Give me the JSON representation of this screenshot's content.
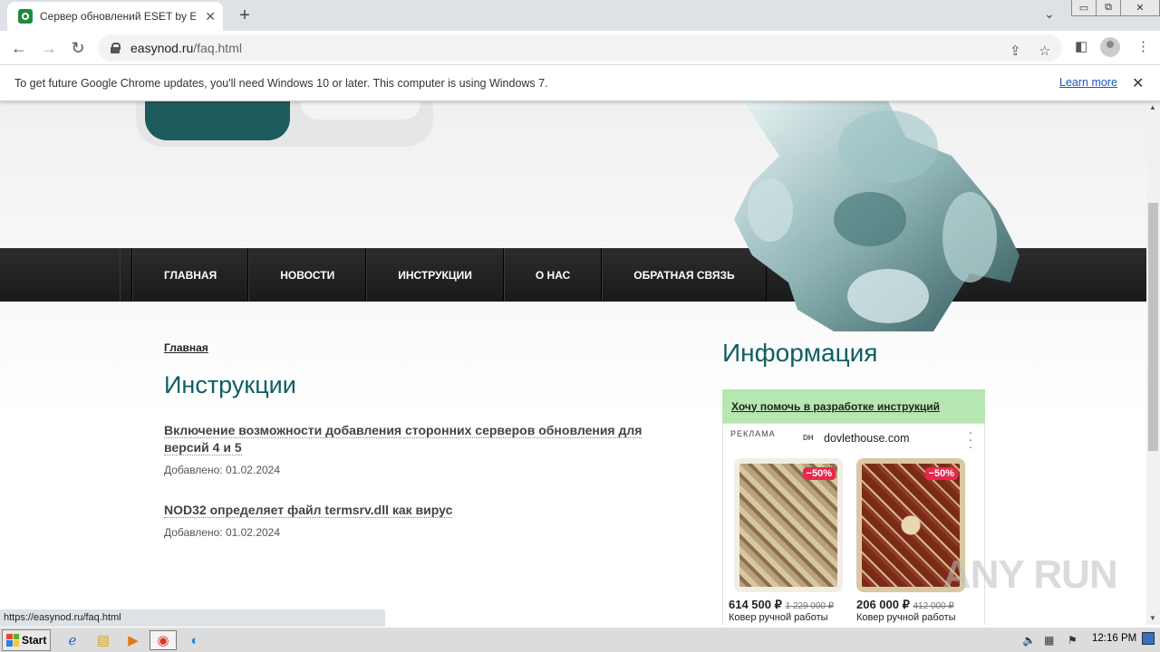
{
  "browser": {
    "tab_title": "Сервер обновлений ESET by EasyNod",
    "url_domain": "easynod.ru",
    "url_path": "/faq.html",
    "new_tab_icon": "plus-icon"
  },
  "infobar": {
    "message": "To get future Google Chrome updates, you'll need Windows 10 or later. This computer is using Windows 7.",
    "learn_more": "Learn more"
  },
  "site": {
    "nav": [
      "ГЛАВНАЯ",
      "НОВОСТИ",
      "ИНСТРУКЦИИ",
      "О НАС",
      "ОБРАТНАЯ СВЯЗЬ"
    ],
    "breadcrumb": "Главная",
    "page_title": "Инструкции",
    "articles": [
      {
        "title": "Включение возможности добавления сторонних серверов обновления для версий 4 и 5",
        "date": "Добавлено: 01.02.2024"
      },
      {
        "title": "NOD32 определяет файл termsrv.dll как вирус",
        "date": "Добавлено: 01.02.2024"
      }
    ],
    "sidebar_title": "Информация",
    "help_link": "Хочу помочь в разработке инструкций"
  },
  "ad": {
    "label": "РЕКЛАМА",
    "logo_text": "DH",
    "domain": "dovlethouse.com",
    "products": [
      {
        "badge": "−50%",
        "price": "614 500 ₽",
        "old_price": "1 229 000 ₽",
        "name": "Ковер ручной работы"
      },
      {
        "badge": "−50%",
        "price": "206 000 ₽",
        "old_price": "412 000 ₽",
        "name": "Ковер ручной работы"
      }
    ]
  },
  "watermark": "ANY RUN",
  "status_url": "https://easynod.ru/faq.html",
  "taskbar": {
    "start": "Start",
    "clock": "12:16 PM"
  },
  "colors": {
    "accent": "#0e5f62",
    "help_bg": "#b7e7b0",
    "badge": "#e8294f"
  }
}
